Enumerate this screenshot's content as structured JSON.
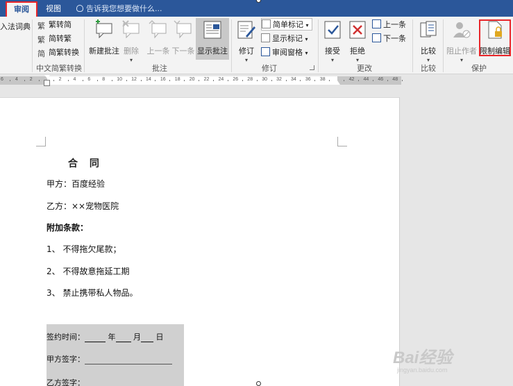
{
  "tabs": [
    {
      "label": "审阅",
      "active": true
    },
    {
      "label": "视图",
      "active": false
    }
  ],
  "tell_me": "告诉我您想要做什么...",
  "ribbon": {
    "partial_left": "入法词典",
    "chinese_conv": {
      "items": [
        "繁转简",
        "简转繁",
        "简繁转换"
      ],
      "group_label": "中文简繁转换"
    },
    "comments": {
      "buttons": [
        "新建批注",
        "删除",
        "上一条",
        "下一条",
        "显示批注"
      ],
      "group_label": "批注"
    },
    "tracking": {
      "track_changes": "修订",
      "markup_select": "简单标记",
      "show_markup": "显示标记",
      "reviewing_pane": "审阅窗格",
      "group_label": "修订"
    },
    "changes": {
      "accept": "接受",
      "reject": "拒绝",
      "previous": "上一条",
      "next": "下一条",
      "group_label": "更改"
    },
    "compare": {
      "button": "比较",
      "group_label": "比较"
    },
    "protect": {
      "block_authors": "阻止作者",
      "restrict_editing": "限制编辑",
      "group_label": "保护"
    }
  },
  "ruler_numbers": [
    "6",
    "4",
    "2",
    "",
    "2",
    "4",
    "6",
    "8",
    "10",
    "12",
    "14",
    "16",
    "18",
    "20",
    "22",
    "24",
    "26",
    "28",
    "30",
    "32",
    "34",
    "36",
    "38",
    "",
    "42",
    "44",
    "46",
    "48"
  ],
  "document": {
    "title": "合 同",
    "party_a": "甲方：百度经验",
    "party_b": "乙方：××宠物医院",
    "clause_heading": "附加条款：",
    "clause_1": "1、 不得拖欠尾款；",
    "clause_2": "2、 不得故意拖延工期",
    "clause_3": "3、 禁止携带私人物品。",
    "sign_time_label": "签约时间：",
    "year": "年",
    "month": "月",
    "day": "日",
    "sign_a": "甲方签字：",
    "sign_b": "乙方签字："
  },
  "watermark": {
    "main": "Bai经验",
    "sub": "jingyan.baidu.com"
  },
  "colors": {
    "title_bar": "#2b579a",
    "highlight": "#e8262a"
  }
}
